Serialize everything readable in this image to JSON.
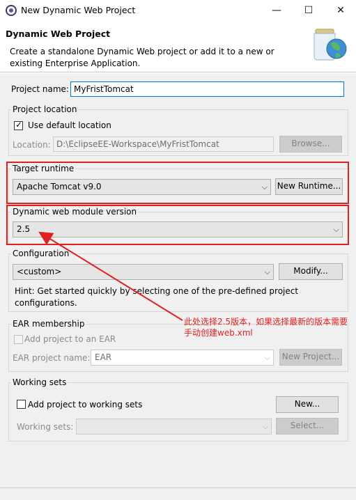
{
  "window": {
    "title": "New Dynamic Web Project",
    "minimize": "—",
    "maximize": "☐",
    "close": "✕"
  },
  "header": {
    "title": "Dynamic Web Project",
    "description": "Create a standalone Dynamic Web project or add it to a new or existing Enterprise Application."
  },
  "project_name": {
    "label": "Project name:",
    "value": "MyFristTomcat"
  },
  "project_location": {
    "group_label": "Project location",
    "use_default_label": "Use default location",
    "use_default_checked": true,
    "location_label": "Location:",
    "location_value": "D:\\EclipseEE-Workspace\\MyFristTomcat",
    "browse_label": "Browse..."
  },
  "target_runtime": {
    "group_label": "Target runtime",
    "value": "Apache Tomcat v9.0",
    "new_runtime_label": "New Runtime..."
  },
  "module_version": {
    "group_label": "Dynamic web module version",
    "value": "2.5"
  },
  "configuration": {
    "group_label": "Configuration",
    "value": "<custom>",
    "modify_label": "Modify...",
    "hint": "Hint: Get started quickly by selecting one of the pre-defined project configurations."
  },
  "ear": {
    "group_label": "EAR membership",
    "add_label": "Add project to an EAR",
    "project_name_label": "EAR project name:",
    "project_name_value": "EAR",
    "new_project_label": "New Project..."
  },
  "working_sets": {
    "group_label": "Working sets",
    "add_label": "Add project to working sets",
    "new_label": "New...",
    "sets_label": "Working sets:",
    "select_label": "Select..."
  },
  "annotation": {
    "text": "此处选择2.5版本，如果选择最新的版本需要手动创建web.xml",
    "color": "#e02020"
  }
}
